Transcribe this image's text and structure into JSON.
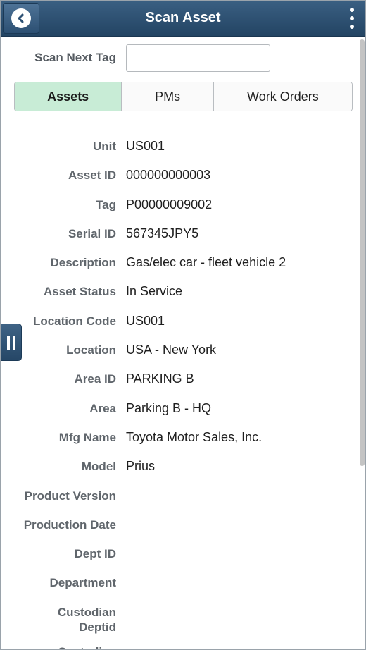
{
  "header": {
    "title": "Scan Asset",
    "back_icon": "chevron-left-icon",
    "menu_icon": "kebab-menu-icon"
  },
  "scan": {
    "label": "Scan Next Tag",
    "value": "",
    "placeholder": ""
  },
  "tabs": [
    {
      "label": "Assets",
      "active": true
    },
    {
      "label": "PMs",
      "active": false
    },
    {
      "label": "Work Orders",
      "active": false
    }
  ],
  "fields": [
    {
      "label": "Unit",
      "value": "US001"
    },
    {
      "label": "Asset ID",
      "value": "000000000003"
    },
    {
      "label": "Tag",
      "value": "P00000009002"
    },
    {
      "label": "Serial ID",
      "value": "567345JPY5"
    },
    {
      "label": "Description",
      "value": "Gas/elec car - fleet vehicle 2"
    },
    {
      "label": "Asset Status",
      "value": "In Service"
    },
    {
      "label": "Location Code",
      "value": "US001"
    },
    {
      "label": "Location",
      "value": "USA - New York"
    },
    {
      "label": "Area ID",
      "value": "PARKING B"
    },
    {
      "label": "Area",
      "value": "Parking B - HQ"
    },
    {
      "label": "Mfg Name",
      "value": "Toyota Motor Sales, Inc."
    },
    {
      "label": "Model",
      "value": "Prius"
    },
    {
      "label": "Product Version",
      "value": ""
    },
    {
      "label": "Production Date",
      "value": ""
    },
    {
      "label": "Dept ID",
      "value": ""
    },
    {
      "label": "Department",
      "value": ""
    },
    {
      "label": "Custodian Deptid",
      "value": ""
    },
    {
      "label": "Custodian",
      "value": ""
    }
  ],
  "colors": {
    "header_bg": "#2d5073",
    "active_tab_bg": "#c8ecd6",
    "label_text": "#60666c"
  }
}
